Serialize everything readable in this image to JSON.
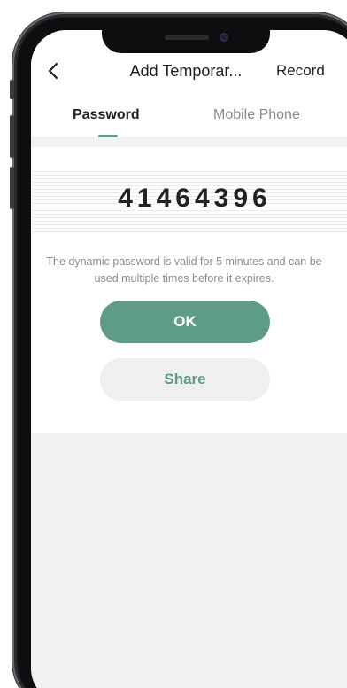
{
  "header": {
    "title": "Add Temporar...",
    "action_label": "Record",
    "back_icon": "chevron-left-icon"
  },
  "tabs": [
    {
      "label": "Password",
      "active": true
    },
    {
      "label": "Mobile Phone",
      "active": false
    }
  ],
  "password": {
    "code": "41464396",
    "hint_line1": "The dynamic password is valid for 5 minutes and can be",
    "hint_line2": "used multiple times before it expires."
  },
  "buttons": {
    "ok_label": "OK",
    "share_label": "Share"
  },
  "colors": {
    "accent": "#5e9b89",
    "background": "#f2f2f4"
  }
}
